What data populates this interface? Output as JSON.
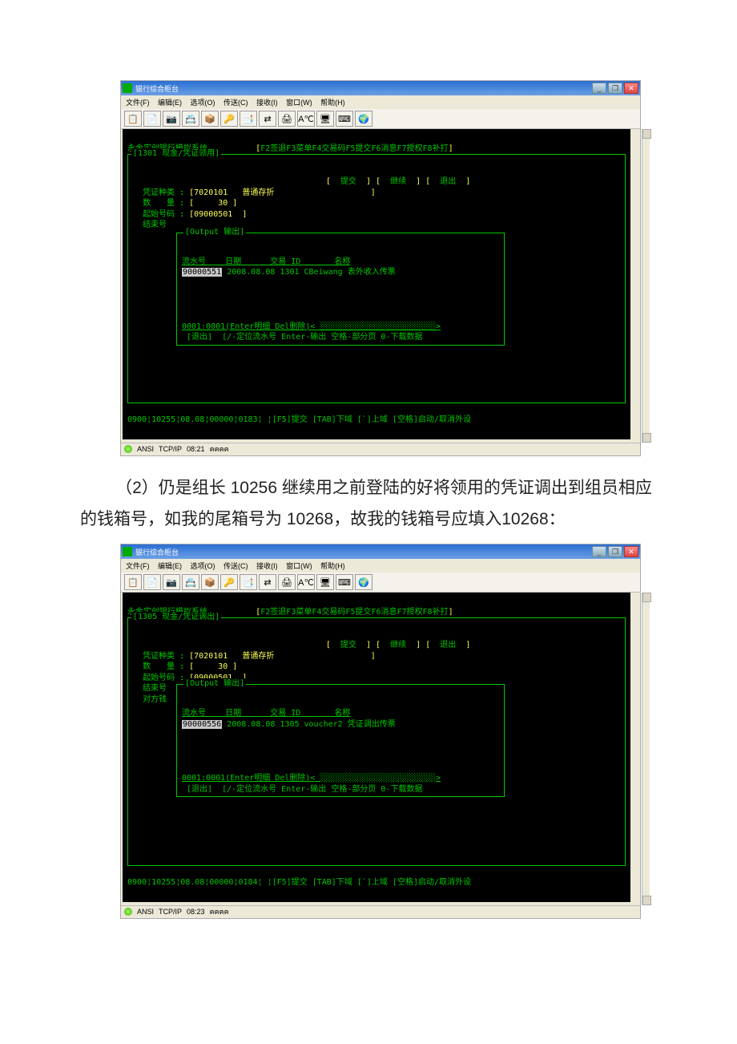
{
  "app_title": "银行综合柜台",
  "win_controls": {
    "min": "_",
    "max": "❐",
    "close": "✕"
  },
  "menubar": [
    "文件(F)",
    "编辑(E)",
    "选项(O)",
    "传送(C)",
    "接收(I)",
    "窗口(W)",
    "帮助(H)"
  ],
  "toolbar_icons": [
    "📋",
    "📄",
    "📷",
    "📇",
    "📦",
    "🔑",
    "📑",
    "⇄",
    "🖨",
    "A℃",
    "🖥",
    "⌨",
    "🌍"
  ],
  "system_name": "永金实创银行模拟系统",
  "fn_bar": {
    "prefix": "[",
    "suffix": "]",
    "items": [
      "F2签退",
      "F3菜单",
      "F4交易码",
      "F5提交",
      "F6消息",
      "F7授权",
      "F8补打"
    ]
  },
  "screen1": {
    "code_line": "[1301 现金/凭证领用]",
    "actions": [
      "提交",
      "继续",
      "退出"
    ],
    "fields": {
      "type_label": "凭证种类",
      "type_value": "[7020101   普通存折",
      "qty_label": "数　　量",
      "qty_value": "[     30 ]",
      "start_label": "起始号码",
      "start_value": "[09000501  ]",
      "end_label": "结束号"
    },
    "output_title": "[Output 输出]",
    "output_headers": "流水号    日期      交易 ID       名称",
    "output_row_serial": "90000551",
    "output_row_rest": " 2008.08.08 1301 CBeiwang 表外收入传票",
    "output_footer1": "0001:0001(Enter明细 Del删除)< ░░░░░░░░░░░░░░░░░░░░░░░░>",
    "output_footer2": " [退出]  [/-定位流水号 Enter-输出 空格-部分页 0-下载数据",
    "bottom_status": "0900¦10255¦08.08¦00000¦0183¦ ¦[F5]提交 [TAB]下域 [`]上域 [空格]启动/取消外设"
  },
  "paragraph": {
    "prefix": "（2）",
    "text": "仍是组长 10256 继续用之前登陆的好将领用的凭证调出到组员相应的钱箱号，如我的尾箱号为 10268，故我的钱箱号应填入10268："
  },
  "screen2": {
    "code_line": "[1305 现金/凭证调出]",
    "actions": [
      "提交",
      "继续",
      "退出"
    ],
    "fields": {
      "type_label": "凭证种类",
      "type_value": "[7020101   普通存折",
      "qty_label": "数　　量",
      "qty_value": "[     30 ]",
      "start_label": "起始号码",
      "start_value": "[09000501  ]",
      "end_label": "结束号",
      "other_label": "对方钱"
    },
    "output_title": "[Output 输出]",
    "output_headers": "流水号    日期      交易 ID       名称",
    "output_row_serial": "90000556",
    "output_row_rest": " 2008.08.08 1305 voucher2 凭证调出传票",
    "output_footer1": "0001:0001(Enter明细 Del删除)< ░░░░░░░░░░░░░░░░░░░░░░░░>",
    "output_footer2": " [退出]  [/-定位流水号 Enter-输出 空格-部分页 0-下载数据",
    "bottom_status": "0900¦10255¦08.08¦00000¦0184¦ ¦[F5]提交 [TAB]下域 [`]上域 [空格]启动/取消外设"
  },
  "statusbar1": {
    "proto": "ANSI",
    "conn": "TCP/IP",
    "time": "08:21",
    "extra": "ฅฅฅฅ"
  },
  "statusbar2": {
    "proto": "ANSI",
    "conn": "TCP/IP",
    "time": "08:23",
    "extra": "ฅฅฅฅ"
  }
}
